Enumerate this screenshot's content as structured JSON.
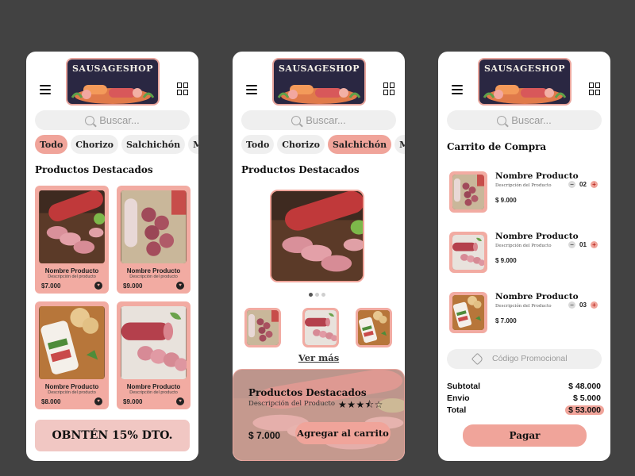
{
  "brand": {
    "logo_text": "SAUSAGESHOP"
  },
  "search": {
    "placeholder": "Buscar..."
  },
  "categories": [
    "Todo",
    "Chorizo",
    "Salchichón",
    "Mangu"
  ],
  "home": {
    "section_title": "Productos Destacados",
    "products": [
      {
        "name": "Nombre Producto",
        "desc": "Descripción del producto",
        "price": "$7.000"
      },
      {
        "name": "Nombre Producto",
        "desc": "Descripción del producto",
        "price": "$9.000"
      },
      {
        "name": "Nombre Producto",
        "desc": "Descripción del producto",
        "price": "$8.000"
      },
      {
        "name": "Nombre Producto",
        "desc": "Descripción del producto",
        "price": "$9.000"
      }
    ],
    "promo_banner": "OBNTÉN 15% DTO."
  },
  "detail": {
    "section_title": "Productos Destacados",
    "see_more": "Ver más",
    "panel_title": "Productos Destacados",
    "panel_desc": "Descripción del Producto",
    "stars": "★★★⯪☆",
    "price": "$ 7.000",
    "add_to_cart": "Agregar al carrito"
  },
  "cart": {
    "title": "Carrito de Compra",
    "items": [
      {
        "name": "Nombre Producto",
        "desc": "Descripción del Producto",
        "price": "$ 9.000",
        "qty": "02"
      },
      {
        "name": "Nombre Producto",
        "desc": "Descripción del Producto",
        "price": "$ 9.000",
        "qty": "01"
      },
      {
        "name": "Nombre Producto",
        "desc": "Descripción del Producto",
        "price": "$ 7.000",
        "qty": "03"
      }
    ],
    "promo_placeholder": "Código Promocional",
    "subtotal_label": "Subtotal",
    "subtotal": "$ 48.000",
    "shipping_label": "Envio",
    "shipping": "$ 5.000",
    "total_label": "Total",
    "total": "$ 53.000",
    "pay": "Pagar"
  },
  "colors": {
    "accent": "#f0a49a",
    "card": "#f2aba2",
    "banner": "#f1c7c3",
    "background": "#424242"
  }
}
